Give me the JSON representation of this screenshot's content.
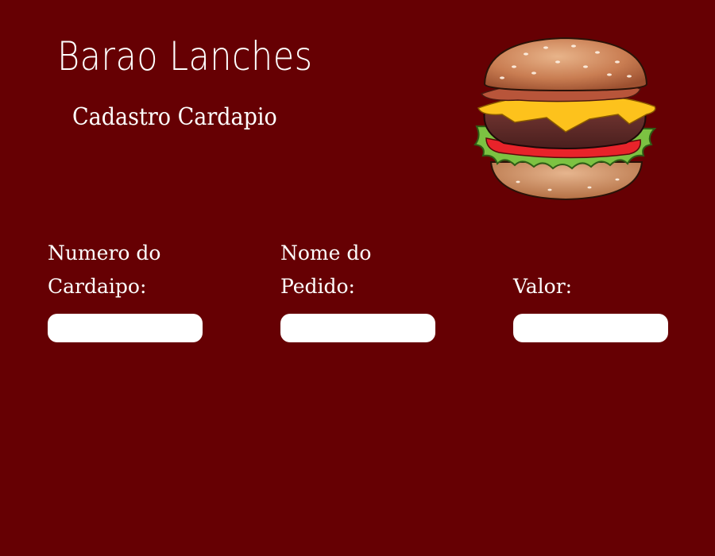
{
  "header": {
    "title": "Barao Lanches",
    "subtitle": "Cadastro Cardapio"
  },
  "logo": {
    "icon": "hamburger-illustration"
  },
  "form": {
    "fields": [
      {
        "label_line1": "Numero do",
        "label_line2": "Cardaipo:",
        "value": "",
        "placeholder": ""
      },
      {
        "label_line1": "Nome do",
        "label_line2": "Pedido:",
        "value": "",
        "placeholder": ""
      },
      {
        "label_line1": "",
        "label_line2": "Valor:",
        "value": "",
        "placeholder": ""
      }
    ]
  },
  "colors": {
    "background": "#660003",
    "text": "#ffffff",
    "input": "#ffffff"
  }
}
